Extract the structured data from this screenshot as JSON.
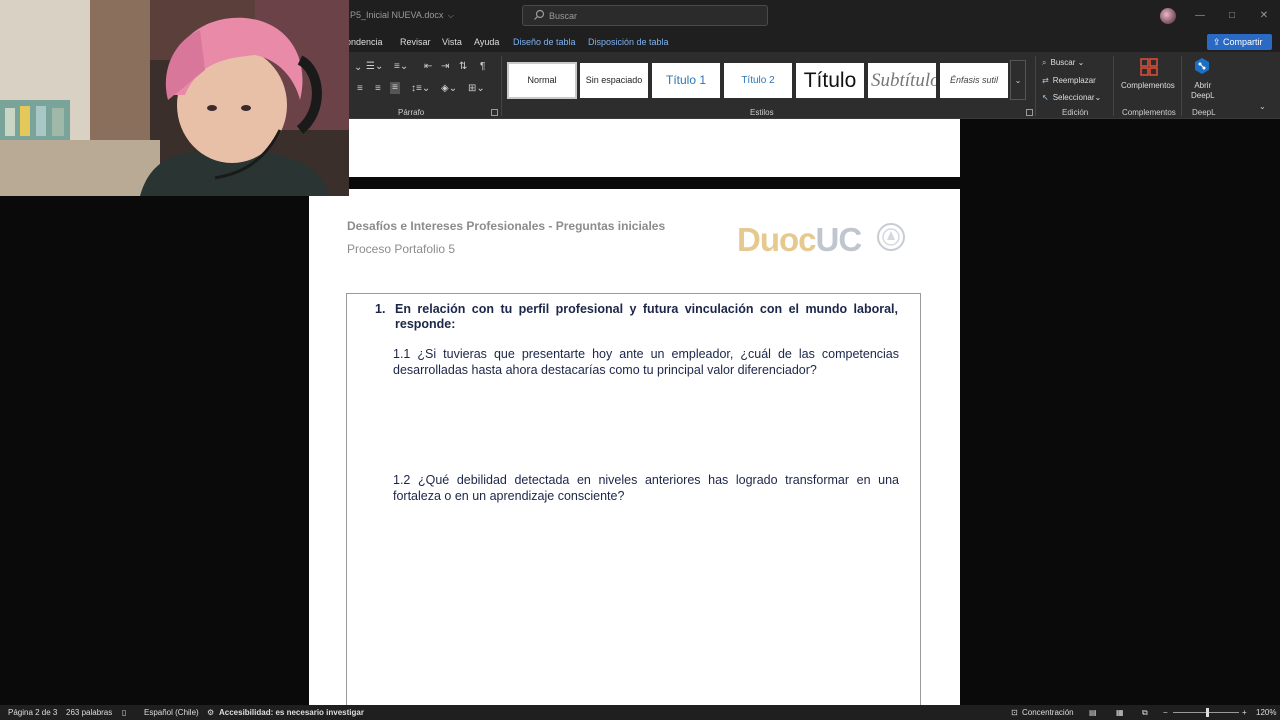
{
  "titlebar": {
    "doc_title": "P5_Inicial NUEVA.docx",
    "search_placeholder": "Buscar",
    "minimize": "—",
    "restore": "□",
    "close": "✕"
  },
  "tabs": {
    "items": [
      "ondencia",
      "Revisar",
      "Vista",
      "Ayuda"
    ],
    "contextual": [
      "Diseño de tabla",
      "Disposición de tabla"
    ],
    "share_label": "Compartir"
  },
  "ribbon": {
    "parrafo_label": "Párrafo",
    "estilos_label": "Estilos",
    "edicion_label": "Edición",
    "complementos_group_label": "Complementos",
    "deepl_group_label": "DeepL",
    "styles": [
      "Normal",
      "Sin espaciado",
      "Título 1",
      "Título 2",
      "Título",
      "Subtítulo",
      "Énfasis sutil"
    ],
    "selected_style": "Normal",
    "edit_items": [
      "Buscar",
      "Reemplazar",
      "Seleccionar"
    ],
    "complementos_button": "Complementos",
    "deepl_button_line1": "Abrir",
    "deepl_button_line2": "DeepL",
    "accent_color": "#e0503a",
    "deepl_color": "#1b6fc4"
  },
  "document": {
    "header_title": "Desafíos e Intereses Profesionales - Preguntas iniciales",
    "header_subtitle": "Proceso Portafolio 5",
    "logo_part1": "Duoc",
    "logo_part2": "UC",
    "q1_number": "1.",
    "q1_text": "En relación con tu perfil profesional y futura vinculación con el mundo laboral, responde:",
    "q1_1": "1.1 ¿Si tuvieras que presentarte hoy ante un empleador, ¿cuál de las competencias desarrolladas hasta ahora destacarías como tu principal valor diferenciador?",
    "q1_2": "1.2 ¿Qué debilidad detectada en niveles anteriores has logrado transformar en una fortaleza o en un aprendizaje consciente?"
  },
  "statusbar": {
    "page": "Página 2 de 3",
    "words": "263 palabras",
    "language": "Español (Chile)",
    "accessibility": "Accesibilidad: es necesario investigar",
    "focus": "Concentración",
    "zoom_minus": "−",
    "zoom_plus": "+",
    "zoom": "120%",
    "zoom_fraction": 0.5
  },
  "icons": [
    "search-icon",
    "avatar",
    "bullets-icon",
    "numbering-icon",
    "multilevel-icon",
    "decrease-indent-icon",
    "increase-indent-icon",
    "sort-icon",
    "pilcrow-icon",
    "align-left-icon",
    "align-center-icon",
    "align-right-icon",
    "justify-icon",
    "line-spacing-icon",
    "shading-icon",
    "borders-icon",
    "find-icon",
    "replace-icon",
    "select-icon",
    "complementos-icon",
    "deepl-icon",
    "book-icon",
    "accessibility-icon",
    "focus-icon",
    "read-mode-icon",
    "print-layout-icon",
    "web-layout-icon"
  ]
}
